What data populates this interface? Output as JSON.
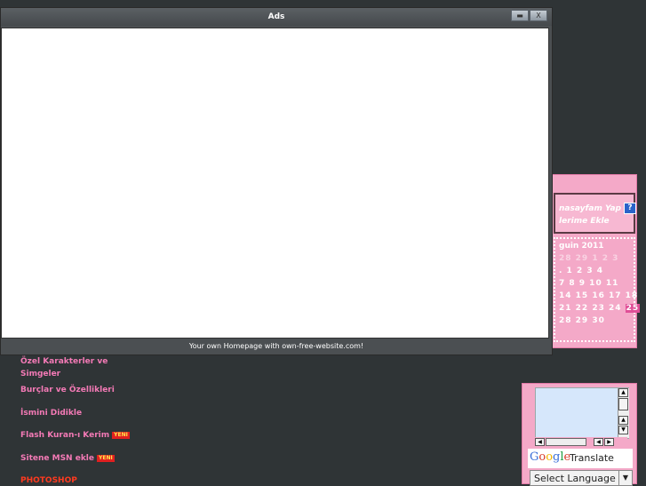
{
  "ads_window": {
    "title": "Ads",
    "footer": "Your own Homepage with own-free-website.com!",
    "minimize_icon": "minimize-icon",
    "close_label": "X"
  },
  "side_widget": {
    "link1": "nasayfam Yap",
    "help_badge": "?",
    "link2": "lerime Ekle",
    "calendar": {
      "title": "guin 2011",
      "header_row": "28 29 1 2 3",
      "rows": [
        ".   1  2  3  4",
        "7  8  9 10 11",
        "14 15 16 17 18",
        "21 22 23 24",
        "28 29 30"
      ],
      "today": "25"
    }
  },
  "left_links": [
    {
      "label": "Özel Karakterler ve",
      "label2": "Simgeler",
      "new": false
    },
    {
      "label": "Burçlar ve Özellikleri",
      "new": false
    },
    {
      "label": "İsmini Didikle",
      "new": false
    },
    {
      "label": "Flash Kuran-ı Kerim",
      "new": true
    },
    {
      "label": "Sitene MSN ekle",
      "new": true
    },
    {
      "label": "PHOTOSHOP",
      "new": false
    }
  ],
  "new_badge": "YENI",
  "translate": {
    "brand": "Google",
    "text": "Translate",
    "select_value": "Select Language"
  },
  "colors": {
    "background": "#2f3436",
    "pink": "#f4a9c8",
    "link_pink": "#f47ab6",
    "link_red": "#ff3a1f"
  }
}
